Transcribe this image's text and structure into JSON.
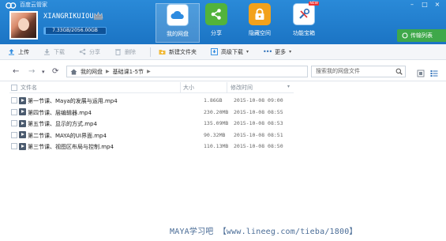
{
  "window": {
    "app_title": "百度云管家",
    "controls": [
      "min-icon",
      "max-icon",
      "close-icon"
    ]
  },
  "user": {
    "name": "XIANGRIKUIOU",
    "quota_text": "7.33GB/2056.00GB",
    "quota_used_fraction": 0.0036
  },
  "nav": [
    {
      "label": "我的网盘",
      "icon": "cloud-icon",
      "active": true
    },
    {
      "label": "分享",
      "icon": "share-icon",
      "active": false
    },
    {
      "label": "隐藏空间",
      "icon": "lock-icon",
      "active": false
    },
    {
      "label": "功能宝箱",
      "icon": "toolbox-icon",
      "active": false,
      "badge": "NEW"
    }
  ],
  "transfer_button": "传输列表",
  "toolbar": {
    "upload": "上传",
    "download": "下载",
    "share": "分享",
    "delete": "删除",
    "new_folder": "新建文件夹",
    "advanced_download": "高级下载",
    "more": "更多"
  },
  "address": {
    "root": "我的网盘",
    "current": "基础课1-5节",
    "search_placeholder": "搜索我的网盘文件"
  },
  "table": {
    "columns": [
      "文件名",
      "大小",
      "修改时间"
    ],
    "rows": [
      {
        "name": "第一节课、Maya的发展与运用.mp4",
        "size": "1.86GB",
        "date": "2015-10-08 09:00"
      },
      {
        "name": "第四节课、层编辑器.mp4",
        "size": "230.20MB",
        "date": "2015-10-08 08:55"
      },
      {
        "name": "第五节课、显示的方式.mp4",
        "size": "135.09MB",
        "date": "2015-10-08 08:53"
      },
      {
        "name": "第二节课、MAYA的UI界面.mp4",
        "size": "90.32MB",
        "date": "2015-10-08 08:51"
      },
      {
        "name": "第三节课、视图区布局与控制.mp4",
        "size": "110.13MB",
        "date": "2015-10-08 08:50"
      }
    ]
  },
  "watermark": "MAYA学习吧 【www.lineeg.com/tieba/1800】",
  "colors": {
    "header_blue": "#2a8ad8",
    "transfer_green": "#3fa84a",
    "share_green": "#52b33b",
    "hide_orange": "#f2a11b"
  }
}
